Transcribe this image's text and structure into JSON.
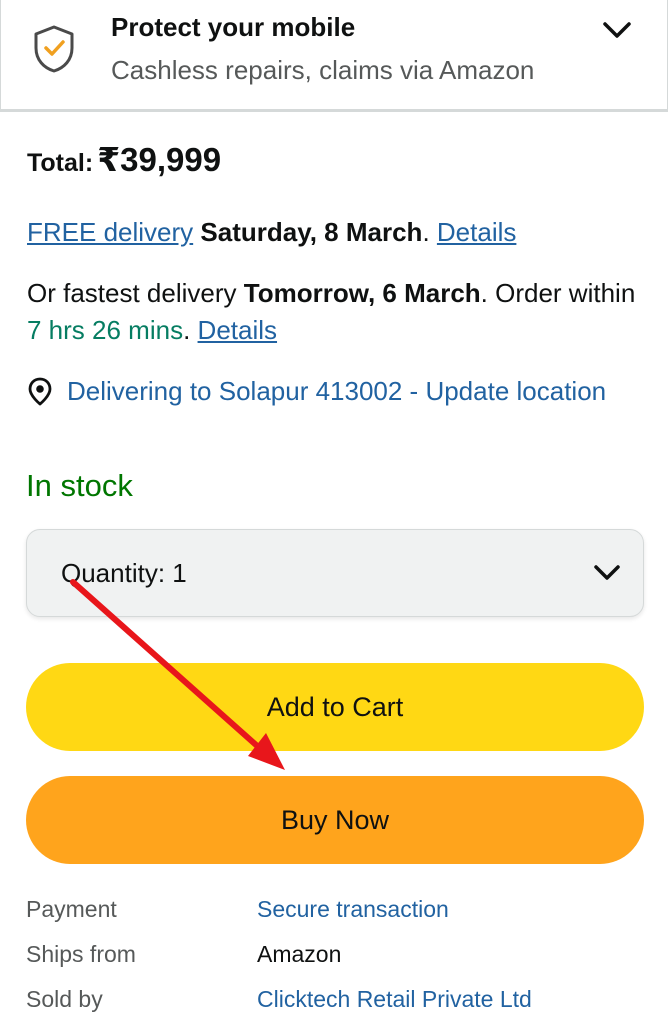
{
  "protect": {
    "title": "Protect your mobile",
    "subtitle": "Cashless repairs, claims via Amazon"
  },
  "total": {
    "label": "Total:",
    "value": "₹39,999"
  },
  "delivery": {
    "free_link": "FREE delivery",
    "free_date": "Saturday, 8 March",
    "free_period": ".",
    "details_1": "Details",
    "fast_prefix": "Or fastest delivery",
    "fast_date": "Tomorrow, 6 March",
    "fast_middle": ". Order within",
    "countdown": "7 hrs 26 mins",
    "fast_period": ".",
    "details_2": "Details"
  },
  "location": {
    "text": "Delivering to Solapur 413002 - Update location"
  },
  "stock": "In stock",
  "quantity": {
    "label": "Quantity:",
    "value": "1"
  },
  "buttons": {
    "add_to_cart": "Add to Cart",
    "buy_now": "Buy Now"
  },
  "info": [
    {
      "label": "Payment",
      "value": "Secure transaction"
    },
    {
      "label": "Ships from",
      "value": "Amazon"
    },
    {
      "label": "Sold by",
      "value": "Clicktech Retail Private Ltd"
    }
  ],
  "colors": {
    "link": "#2162a1",
    "green": "#067d62",
    "stock": "#007600",
    "cart_button": "#ffd814",
    "buy_button": "#ffa41c",
    "annotation_arrow": "#e8161b"
  },
  "icons": {
    "protect": "shield-check-icon",
    "expand": "chevron-down-icon",
    "location": "location-pin-icon",
    "quantity": "chevron-down-icon"
  }
}
